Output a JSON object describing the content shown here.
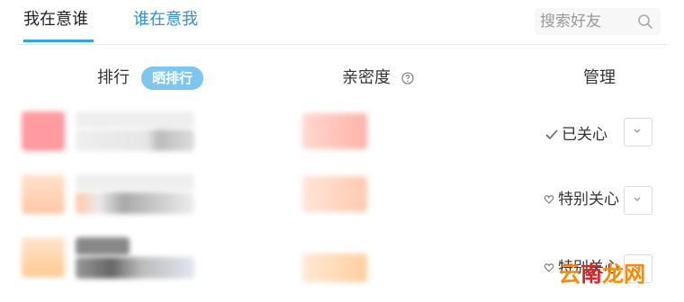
{
  "tabs": [
    {
      "label": "我在意谁",
      "active": true
    },
    {
      "label": "谁在意我",
      "active": false
    }
  ],
  "search": {
    "placeholder": "搜索好友",
    "icon": "search-icon"
  },
  "columns": {
    "rank": "排行",
    "sort_badge": "晒排行",
    "intimacy": "亲密度",
    "intimacy_help_icon": "question-circle-icon",
    "manage": "管理"
  },
  "rows": [
    {
      "action_label": "已关心",
      "action_icon": "check-icon"
    },
    {
      "action_label": "特别关心",
      "action_icon": "heart-outline-icon"
    },
    {
      "action_label": "特别关心",
      "action_icon": "heart-outline-icon"
    }
  ],
  "colors": {
    "accent": "#2fa6e0",
    "link": "#2f8fd8",
    "badge": "#7cc6ef"
  },
  "watermark": {
    "a": "云",
    "b": "南",
    "c": "龙网"
  }
}
